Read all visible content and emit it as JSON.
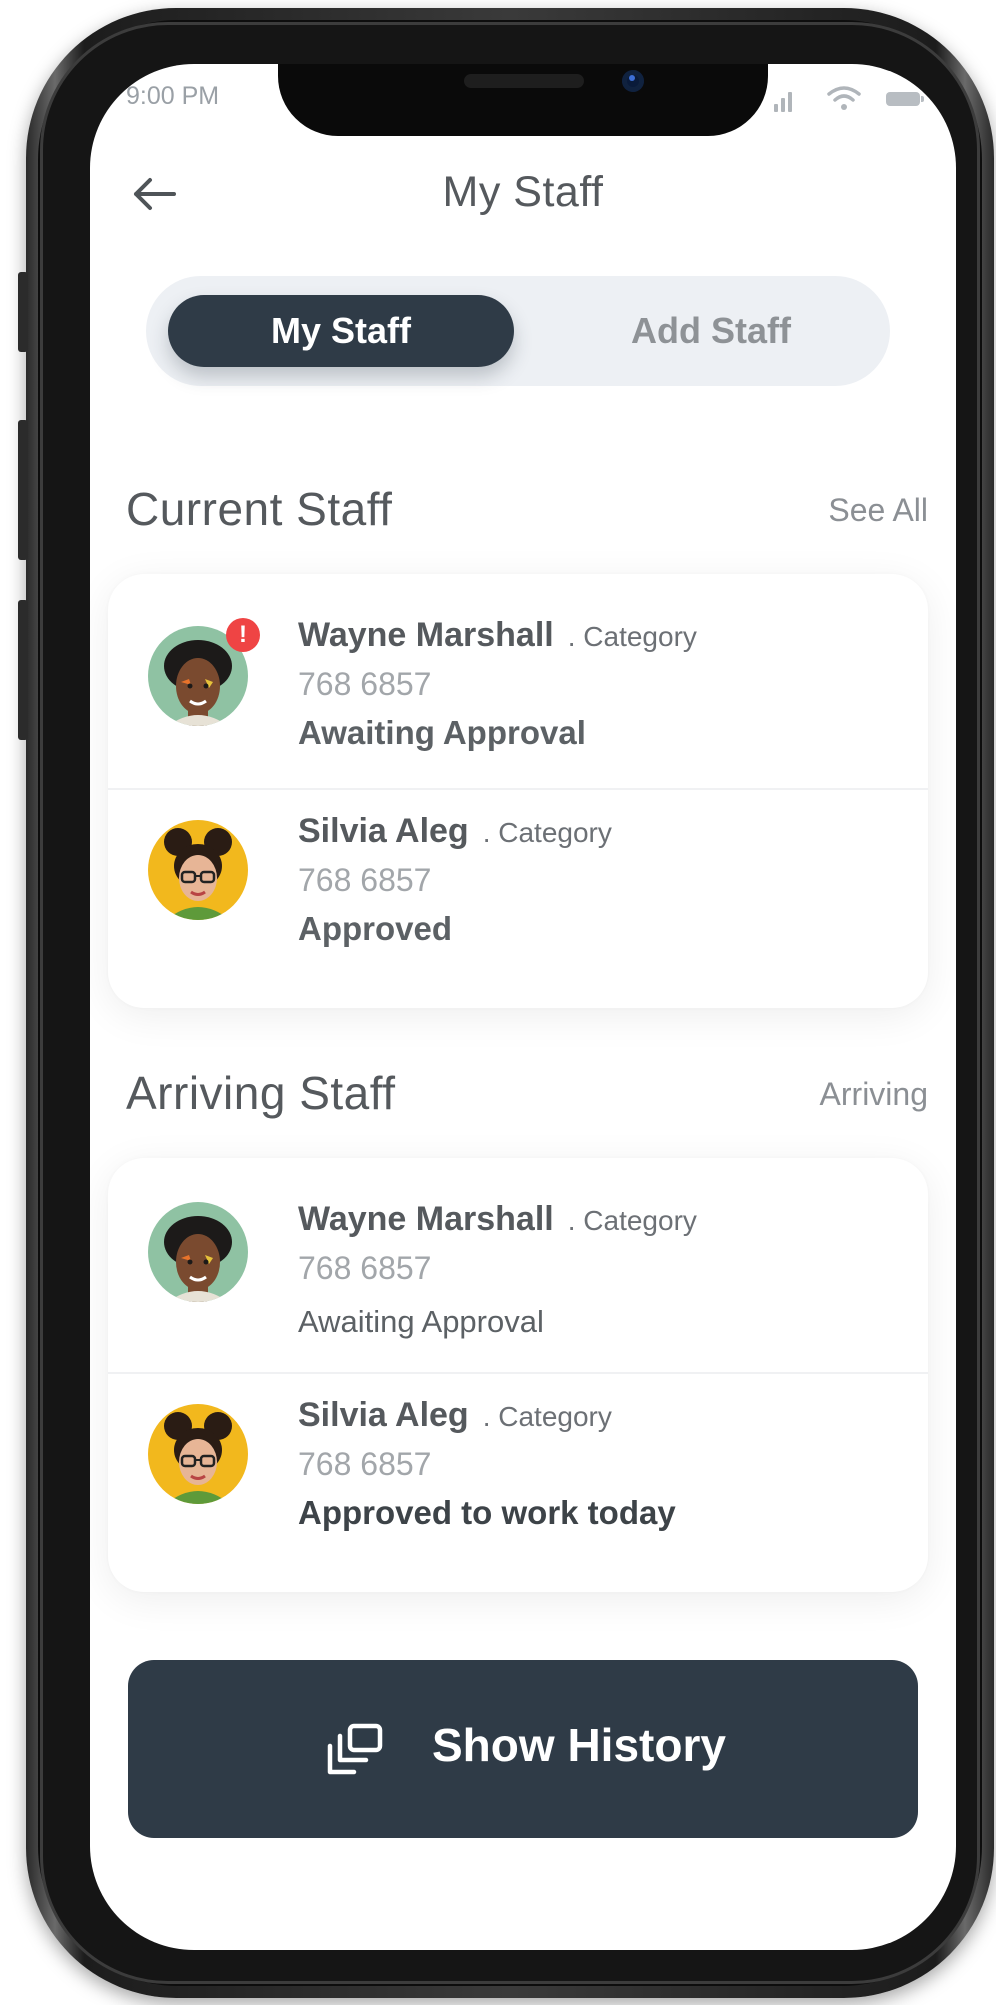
{
  "status_bar": {
    "time": "9:00 PM"
  },
  "header": {
    "title": "My Staff"
  },
  "tabs": [
    {
      "label": "My Staff",
      "active": true
    },
    {
      "label": "Add Staff",
      "active": false
    }
  ],
  "current_staff": {
    "title": "Current Staff",
    "link": "See All",
    "items": [
      {
        "name": "Wayne Marshall",
        "category": ". Category",
        "phone": "768 6857",
        "status": "Awaiting Approval",
        "alert": "!"
      },
      {
        "name": "Silvia Aleg",
        "category": ". Category",
        "phone": "768 6857",
        "status": "Approved"
      }
    ]
  },
  "arriving_staff": {
    "title": "Arriving Staff",
    "link": "Arriving",
    "items": [
      {
        "name": "Wayne Marshall",
        "category": ". Category",
        "phone": "768 6857",
        "status": "Awaiting Approval"
      },
      {
        "name": "Silvia Aleg",
        "category": ". Category",
        "phone": "768 6857",
        "status": "Approved to work today"
      }
    ]
  },
  "action": {
    "label": "Show History",
    "icon": "history-copy-icon"
  },
  "colors": {
    "primary_dark": "#2f3b47",
    "segment_bg": "#edf0f4",
    "alert": "#ef4444"
  }
}
